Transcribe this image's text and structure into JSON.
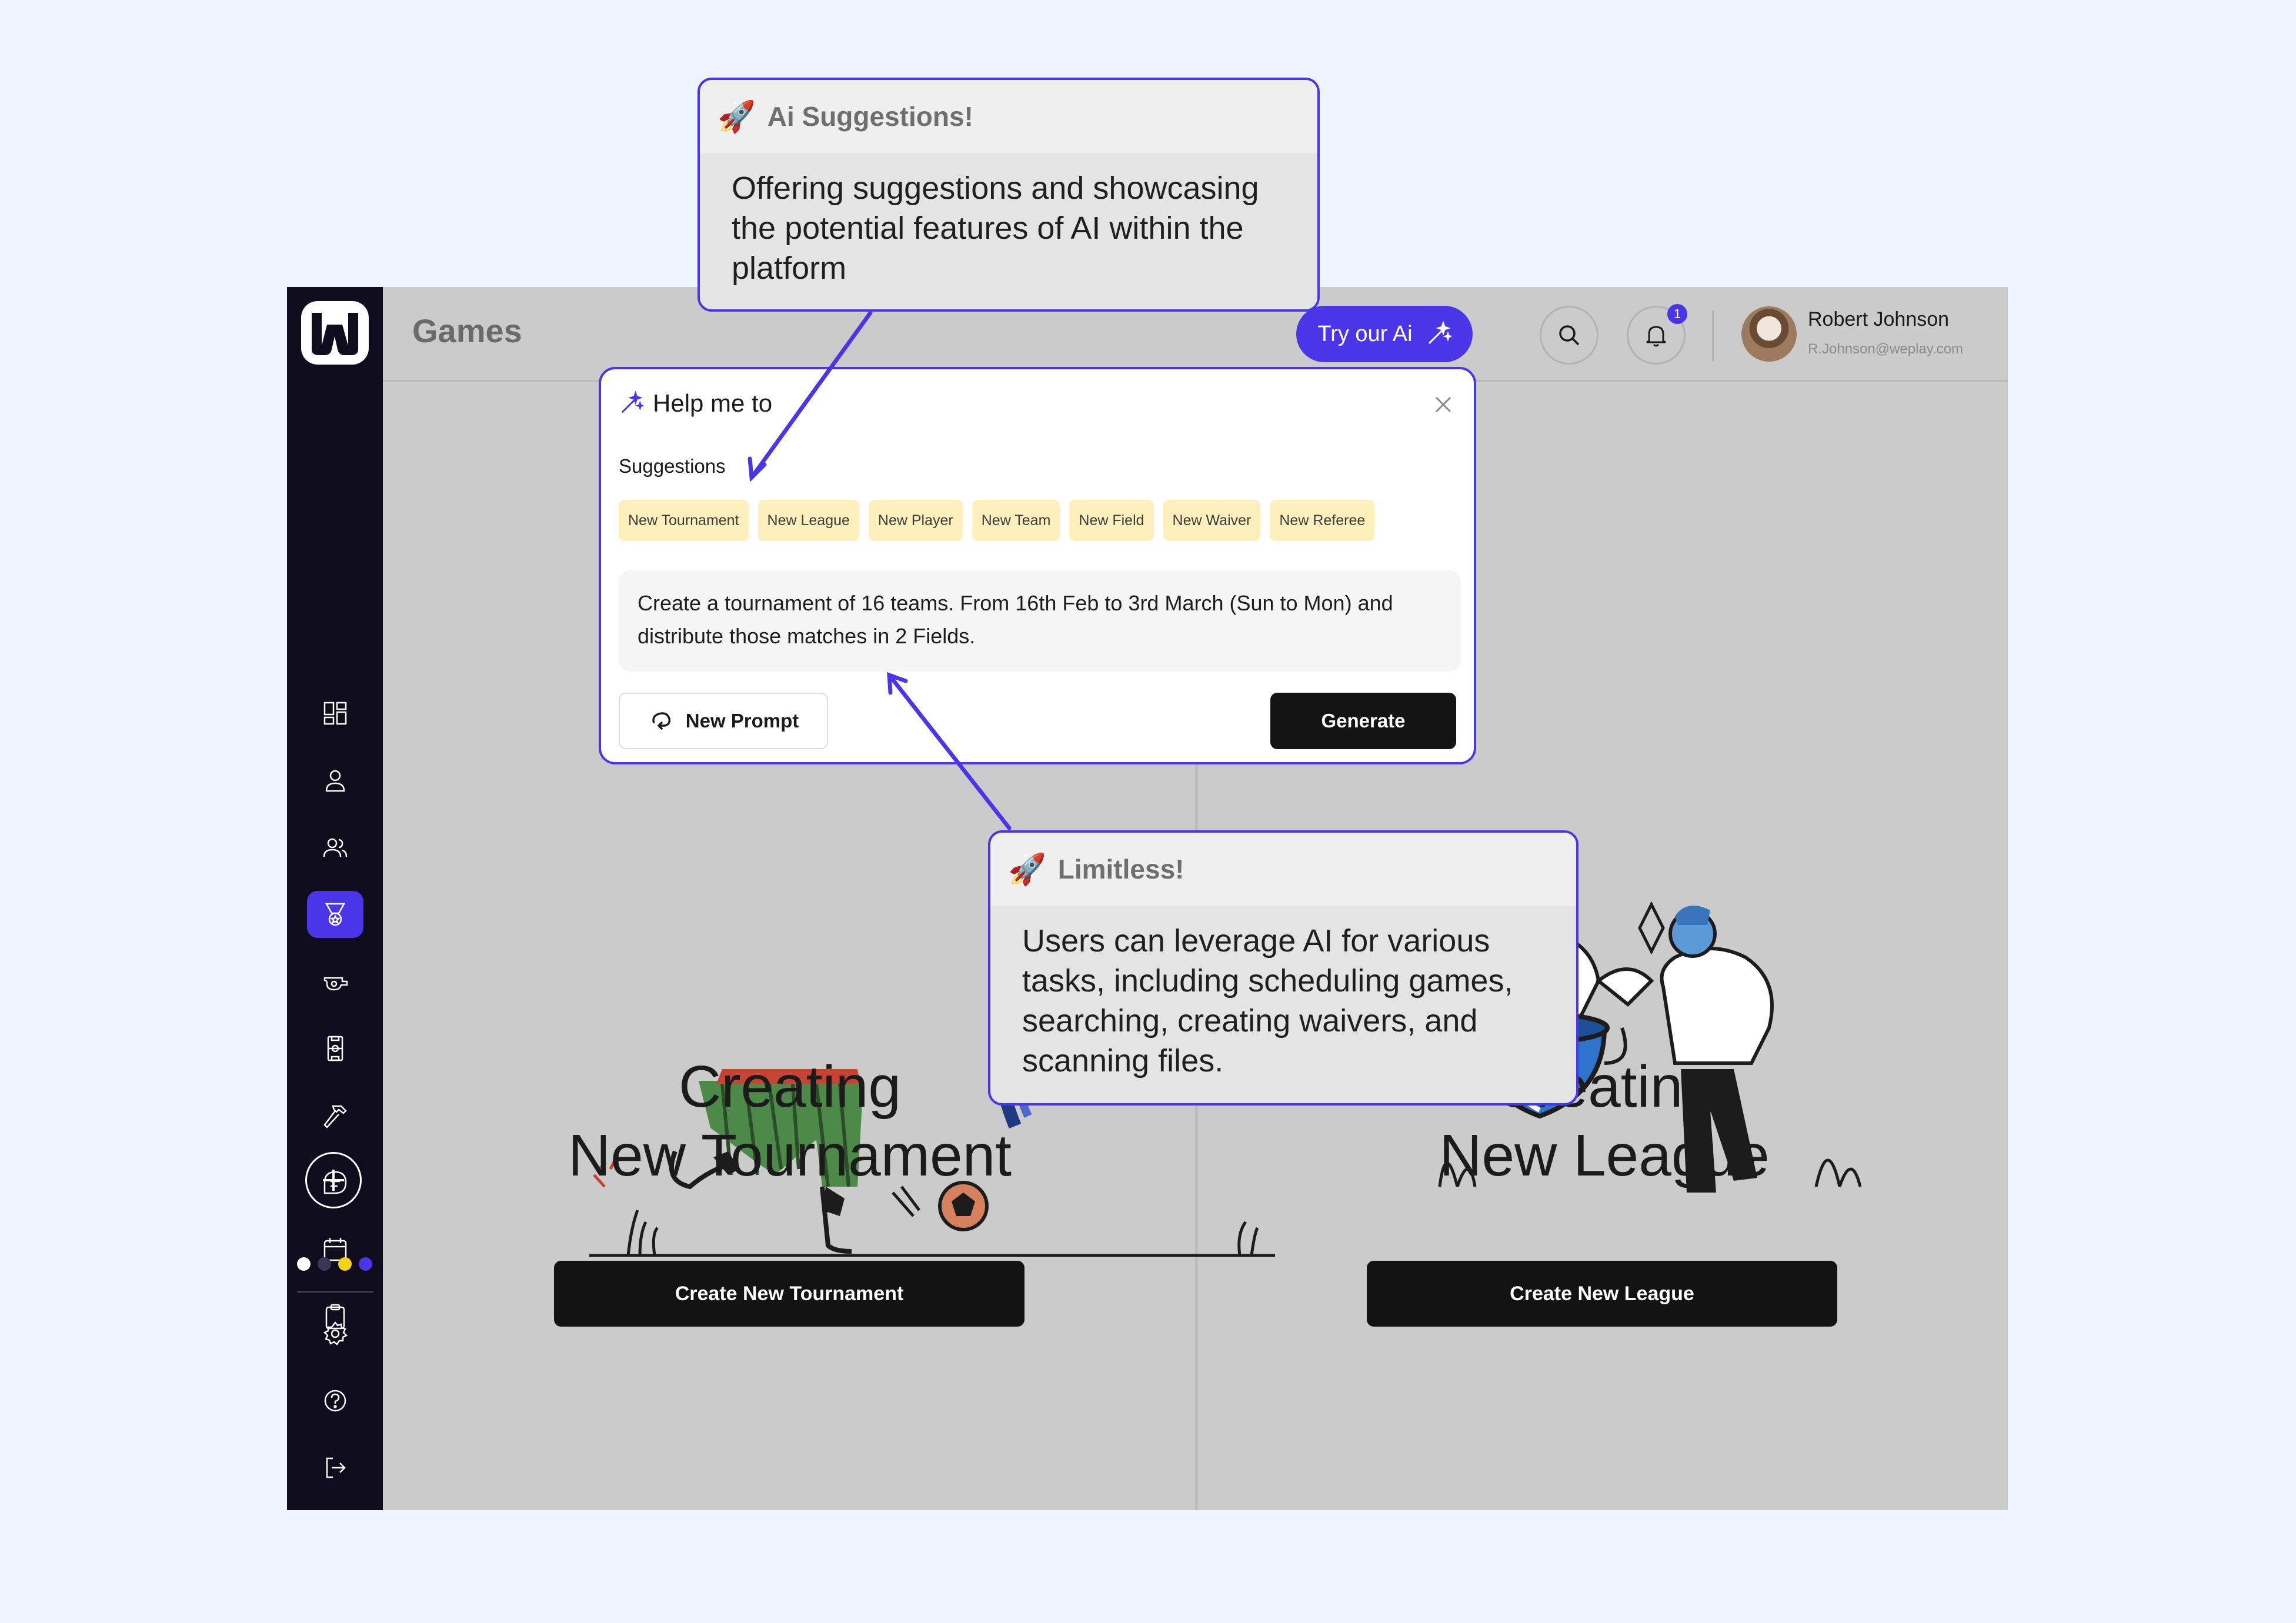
{
  "header": {
    "page_title": "Games",
    "try_ai_label": "Try our Ai",
    "notification_count": "1",
    "user": {
      "name": "Robert Johnson",
      "email": "R.Johnson@weplay.com"
    }
  },
  "sidebar": {
    "items": [
      {
        "icon": "dashboard-icon"
      },
      {
        "icon": "user-icon"
      },
      {
        "icon": "users-icon"
      },
      {
        "icon": "medal-icon",
        "active": true
      },
      {
        "icon": "whistle-icon"
      },
      {
        "icon": "field-icon"
      },
      {
        "icon": "hammer-icon"
      },
      {
        "icon": "chat-icon"
      },
      {
        "icon": "calendar-icon"
      },
      {
        "icon": "clipboard-icon"
      }
    ],
    "theme_colors": [
      "#ffffff",
      "#3b3658",
      "#f5d312",
      "#4b35e8"
    ],
    "bottom_items": [
      {
        "icon": "gear-icon"
      },
      {
        "icon": "help-icon"
      },
      {
        "icon": "logout-icon"
      }
    ]
  },
  "modal": {
    "title": "Help me to",
    "suggestions_label": "Suggestions",
    "chips": [
      "New Tournament",
      "New League",
      "New Player",
      "New Team",
      "New Field",
      "New Waiver",
      "New Referee"
    ],
    "prompt_text": "Create a tournament of 16 teams. From 16th Feb to 3rd March (Sun to Mon) and distribute those matches in 2 Fields.",
    "new_prompt_label": "New Prompt",
    "generate_label": "Generate"
  },
  "panels": {
    "left": {
      "title_line1": "Creating",
      "title_line2": "New Tournament",
      "button_label": "Create New Tournament"
    },
    "right": {
      "title_line1": "Creating",
      "title_line2": "New League",
      "button_label": "Create New League"
    }
  },
  "callouts": {
    "ai_suggestions": {
      "title": "Ai Suggestions!",
      "body": "Offering suggestions and showcasing the potential features of AI within the platform"
    },
    "limitless": {
      "title": "Limitless!",
      "body": "Users can leverage AI for various tasks, including scheduling games, searching, creating waivers, and scanning files."
    }
  },
  "colors": {
    "accent": "#4b35e8",
    "chip_bg": "#fdf0bd",
    "sidebar_bg": "#0e0c1d",
    "page_bg": "#edf4fe"
  }
}
